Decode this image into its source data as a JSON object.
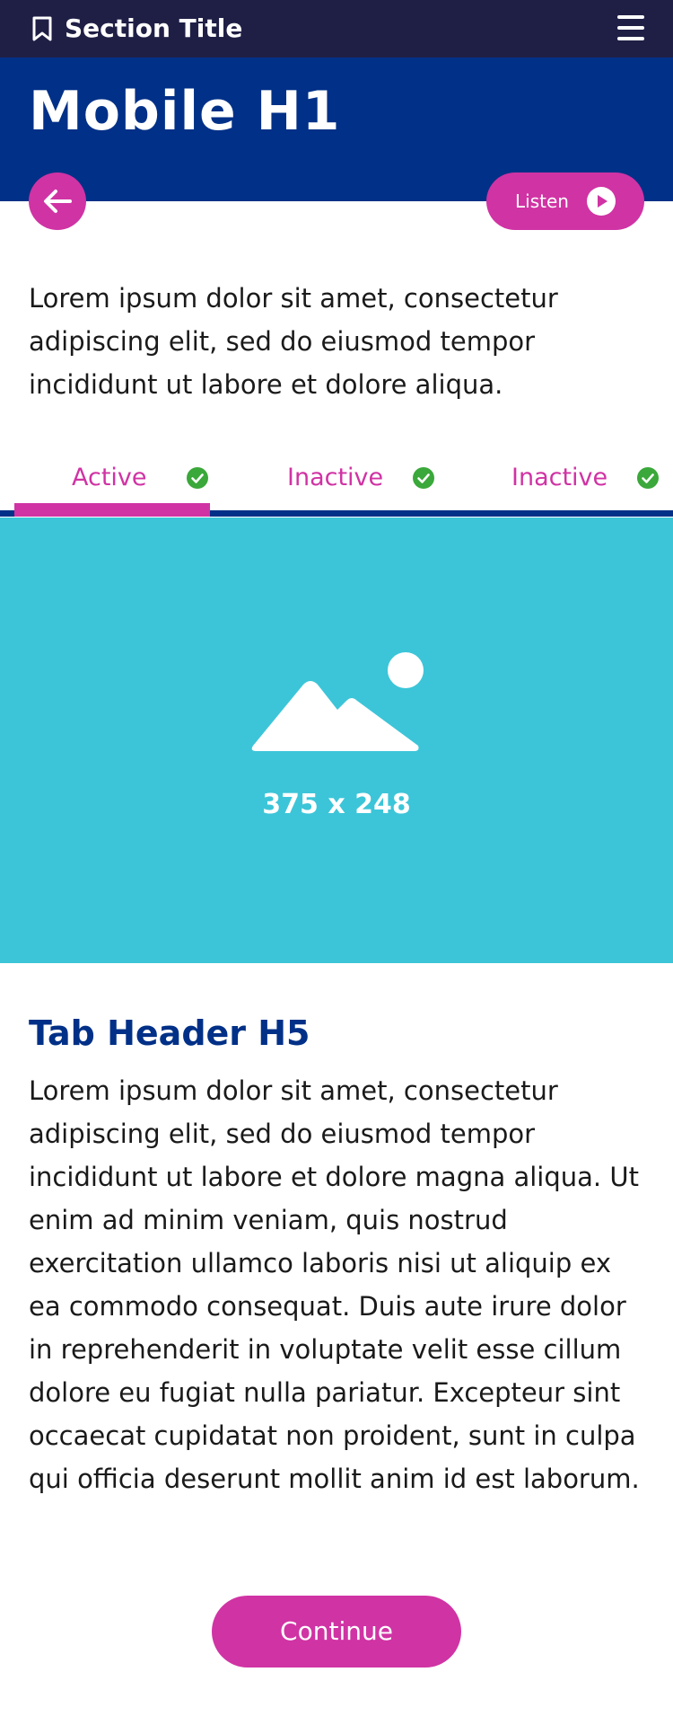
{
  "header": {
    "section_title": "Section Title",
    "bookmark_icon": "bookmark-icon",
    "menu_icon": "hamburger-menu-icon"
  },
  "hero": {
    "title": "Mobile H1"
  },
  "actions": {
    "back_icon": "arrow-left-icon",
    "listen_label": "Listen",
    "play_icon": "play-icon"
  },
  "intro": {
    "text": "Lorem ipsum dolor sit amet, consectetur adipiscing elit, sed do eiusmod tempor incididunt ut labore et dolore aliqua."
  },
  "tabs": [
    {
      "label": "Active",
      "state": "active",
      "icon": "check-circle-icon"
    },
    {
      "label": "Inactive",
      "state": "inactive",
      "icon": "check-circle-icon"
    },
    {
      "label": "Inactive",
      "state": "inactive",
      "icon": "check-circle-icon"
    }
  ],
  "image": {
    "icon": "image-placeholder-icon",
    "dimensions_label": "375 x 248"
  },
  "content": {
    "heading": "Tab Header H5",
    "body": "Lorem ipsum dolor sit amet, consectetur adipiscing elit, sed do eiusmod tempor incididunt ut labore et dolore magna aliqua. Ut enim ad minim veniam, quis nostrud exercitation ullamco laboris nisi ut aliquip ex ea commodo consequat. Duis aute irure dolor in reprehenderit in voluptate velit esse cillum dolore eu fugiat nulla pariatur. Excepteur sint occaecat cupidatat non proident, sunt in culpa qui officia deserunt mollit anim id est laborum."
  },
  "footer": {
    "continue_label": "Continue"
  },
  "colors": {
    "topbar": "#1f1f46",
    "brand_blue": "#003087",
    "accent_pink": "#d033a4",
    "image_teal": "#3cc5d8",
    "check_green": "#3aa83a"
  }
}
